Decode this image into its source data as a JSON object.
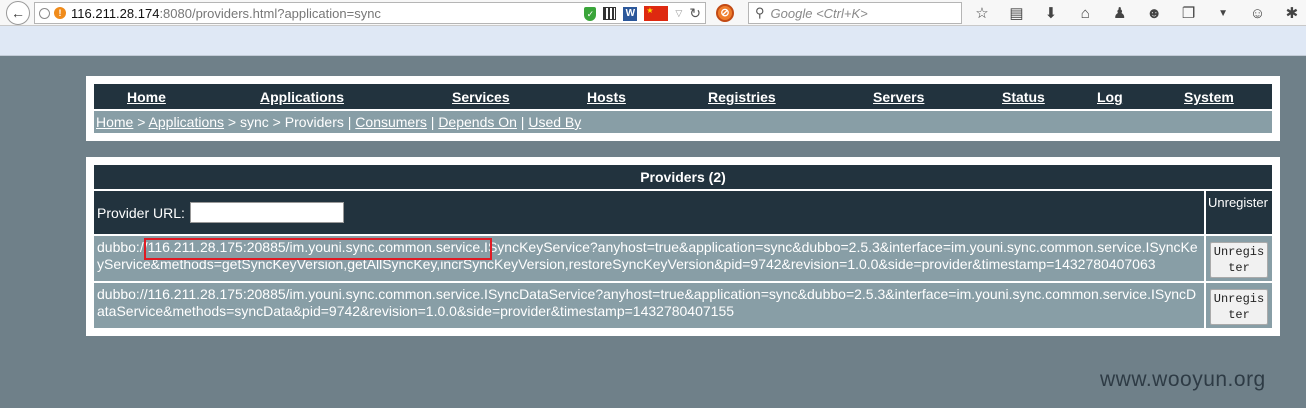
{
  "browser": {
    "url_host": "116.211.28.174",
    "url_path": ":8080/providers.html?application=sync",
    "search_placeholder": "Google <Ctrl+K>",
    "toolbar_icons": [
      "star-icon",
      "clipboard-icon",
      "download-icon",
      "home-icon",
      "user-icon",
      "smiley-icon",
      "page-icon",
      "dropdown-icon",
      "chat-icon",
      "bug-icon"
    ]
  },
  "nav": {
    "items": [
      "Home",
      "Applications",
      "Services",
      "Hosts",
      "Registries",
      "Servers",
      "Status",
      "Log",
      "System"
    ]
  },
  "breadcrumb": {
    "home": "Home",
    "sep1": " > ",
    "applications": "Applications",
    "mid": " > sync > Providers | ",
    "consumers": "Consumers",
    "sep2": " | ",
    "depends_on": "Depends On",
    "sep3": " | ",
    "used_by": "Used By"
  },
  "providers": {
    "title": "Providers (2)",
    "filter_label": "Provider URL:",
    "filter_value": "",
    "unregister_header": "Unregister",
    "rows": [
      {
        "url": "dubbo://116.211.28.175:20885/im.youni.sync.common.service.ISyncKeyService?anyhost=true&application=sync&dubbo=2.5.3&interface=im.youni.sync.common.service.ISyncKeyService&methods=getSyncKeyVersion,getAllSyncKey,incrSyncKeyVersion,restoreSyncKeyVersion&pid=9742&revision=1.0.0&side=provider&timestamp=1432780407063",
        "button": "Unregister"
      },
      {
        "url": "dubbo://116.211.28.175:20885/im.youni.sync.common.service.ISyncDataService?anyhost=true&application=sync&dubbo=2.5.3&interface=im.youni.sync.common.service.ISyncDataService&methods=syncData&pid=9742&revision=1.0.0&side=provider&timestamp=1432780407155",
        "button": "Unregister"
      }
    ]
  },
  "watermark": "www.wooyun.org",
  "colors": {
    "header_bg": "#22333e",
    "row_bg": "#889ea6",
    "page_bg": "#6f8089",
    "highlight": "#e01b24"
  }
}
